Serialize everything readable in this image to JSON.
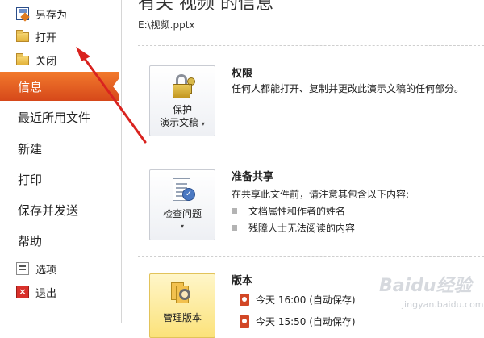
{
  "nav": {
    "small_top": [
      {
        "label": "另存为",
        "icon": "save-as-icon"
      },
      {
        "label": "打开",
        "icon": "open-folder-icon"
      },
      {
        "label": "关闭",
        "icon": "close-folder-icon"
      }
    ],
    "big": [
      {
        "label": "信息",
        "active": true
      },
      {
        "label": "最近所用文件"
      },
      {
        "label": "新建"
      },
      {
        "label": "打印"
      },
      {
        "label": "保存并发送"
      },
      {
        "label": "帮助"
      }
    ],
    "small_bottom": [
      {
        "label": "选项",
        "icon": "options-icon"
      },
      {
        "label": "退出",
        "icon": "exit-icon"
      }
    ]
  },
  "main": {
    "title": "有关 视频 的信息",
    "path": "E:\\视频.pptx",
    "sections": [
      {
        "tile_lines": [
          "保护",
          "演示文稿"
        ],
        "tile_icon": "lock-key-icon",
        "title": "权限",
        "text": "任何人都能打开、复制并更改此演示文稿的任何部分。"
      },
      {
        "tile_lines": [
          "检查问题"
        ],
        "tile_icon": "inspect-document-icon",
        "title": "准备共享",
        "text": "在共享此文件前，请注意其包含以下内容:",
        "bullets": [
          "文档属性和作者的姓名",
          "残障人士无法阅读的内容"
        ]
      },
      {
        "tile_lines": [
          "管理版本"
        ],
        "tile_icon": "manage-versions-icon",
        "title": "版本",
        "versions": [
          "今天 16:00 (自动保存)",
          "今天 15:50 (自动保存)"
        ]
      }
    ]
  },
  "watermark": {
    "main": "Baidu经验",
    "sub": "jingyan.baidu.com"
  },
  "colors": {
    "active_tab": "#e35f22",
    "annotation_arrow": "#d9231f",
    "tile_highlight": "#fbe27a"
  }
}
